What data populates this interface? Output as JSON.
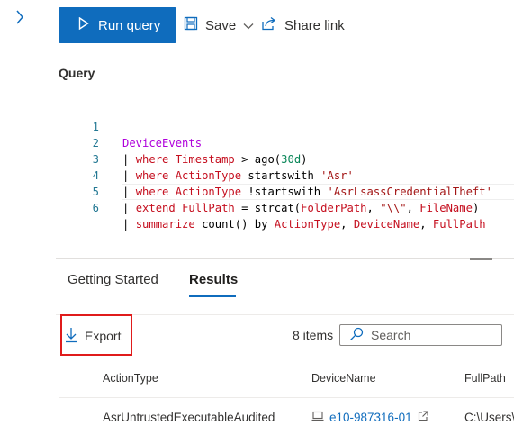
{
  "toolbar": {
    "run_label": "Run query",
    "save_label": "Save",
    "share_label": "Share link"
  },
  "query": {
    "label": "Query",
    "lines": [
      {
        "n": "1"
      },
      {
        "n": "2"
      },
      {
        "n": "3"
      },
      {
        "n": "4"
      },
      {
        "n": "5"
      },
      {
        "n": "6"
      }
    ],
    "tokens": {
      "l1_table": "DeviceEvents",
      "l2_pipe": "| ",
      "l2_where": "where",
      "l2_col": "Timestamp",
      "l2_rest": " > ago(",
      "l2_num": "30d",
      "l2_end": ")",
      "l3_pipe": "| ",
      "l3_where": "where",
      "l3_col": "ActionType",
      "l3_op": " startswith ",
      "l3_str": "'Asr'",
      "l4_pipe": "| ",
      "l4_where": "where",
      "l4_col": "ActionType",
      "l4_op": " !startswith ",
      "l4_str": "'AsrLsassCredentialTheft'",
      "l5_pipe": "| ",
      "l5_extend": "extend",
      "l5_col": "FullPath",
      "l5_mid": " = strcat(",
      "l5_arg1": "FolderPath",
      "l5_comma": ", ",
      "l5_str": "\"\\\\\"",
      "l5_comma2": ", ",
      "l5_arg2": "FileName",
      "l5_end": ")",
      "l6_pipe": "| ",
      "l6_kw": "summarize",
      "l6_mid": " count() by ",
      "l6_a": "ActionType",
      "l6_c1": ", ",
      "l6_b": "DeviceName",
      "l6_c2": ", ",
      "l6_c": "FullPath"
    }
  },
  "tabs": {
    "getting_started": "Getting Started",
    "results": "Results"
  },
  "results": {
    "export_label": "Export",
    "count_label": "8 items",
    "search_placeholder": "Search",
    "columns": [
      "ActionType",
      "DeviceName",
      "FullPath"
    ],
    "rows": [
      {
        "action_type": "AsrUntrustedExecutableAudited",
        "device_name": "e10-987316-01",
        "full_path": "C:\\Users\\"
      }
    ]
  }
}
